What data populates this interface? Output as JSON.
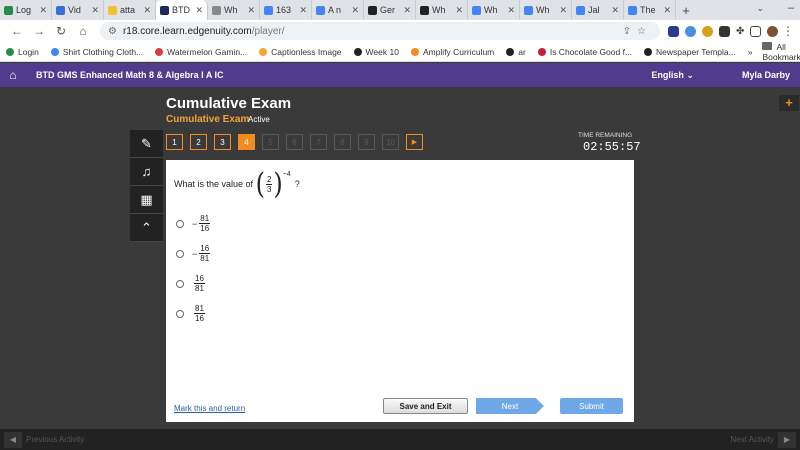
{
  "browser": {
    "tabs": [
      {
        "label": "Log",
        "color": "#2a8c4a"
      },
      {
        "label": "Vid",
        "color": "#3a6fd8"
      },
      {
        "label": "atta",
        "color": "#f2c230"
      },
      {
        "label": "BTD",
        "color": "#1c2a5a",
        "active": true
      },
      {
        "label": "Wh",
        "color": "#888888"
      },
      {
        "label": "163",
        "color": "#4285f4"
      },
      {
        "label": "A n",
        "color": "#4285f4"
      },
      {
        "label": "Ger",
        "color": "#222222"
      },
      {
        "label": "Wh",
        "color": "#222222"
      },
      {
        "label": "Wh",
        "color": "#4285f4"
      },
      {
        "label": "Wh",
        "color": "#4285f4"
      },
      {
        "label": "Jal",
        "color": "#4285f4"
      },
      {
        "label": "The",
        "color": "#4285f4"
      }
    ],
    "url_host": "r18.core.learn.edgenuity.com",
    "url_path": "/player/",
    "bookmarks": [
      {
        "label": "Login",
        "color": "#2a8c4a"
      },
      {
        "label": "Shirt Clothing Cloth...",
        "color": "#4285f4"
      },
      {
        "label": "Watermelon Gamin...",
        "color": "#d84040"
      },
      {
        "label": "Captionless Image",
        "color": "#f2a537"
      },
      {
        "label": "Week 10",
        "color": "#222222"
      },
      {
        "label": "Amplify Curriculum",
        "color": "#f28c1e"
      },
      {
        "label": "ar",
        "color": "#222222"
      },
      {
        "label": "Is Chocolate Good f...",
        "color": "#c0203a"
      },
      {
        "label": "Newspaper Templa...",
        "color": "#222222"
      }
    ],
    "all_bookmarks": "All Bookmarks"
  },
  "app": {
    "course": "BTD GMS Enhanced Math 8 & Algebra I A IC",
    "language": "English",
    "user": "Myla Darby"
  },
  "exam": {
    "title": "Cumulative Exam",
    "subtitle": "Cumulative Exam",
    "status": "Active",
    "timer_label": "TIME REMAINING",
    "timer": "02:55:57",
    "questions": [
      "1",
      "2",
      "3",
      "4",
      "5",
      "6",
      "7",
      "8",
      "9",
      "10"
    ],
    "current_question": 4
  },
  "question": {
    "prefix": "What is the value of",
    "base_num": "2",
    "base_den": "3",
    "exponent": "−4",
    "suffix": "?",
    "options": [
      {
        "sign": "−",
        "num": "81",
        "den": "16"
      },
      {
        "sign": "−",
        "num": "16",
        "den": "81"
      },
      {
        "sign": "",
        "num": "16",
        "den": "81"
      },
      {
        "sign": "",
        "num": "81",
        "den": "16"
      }
    ]
  },
  "actions": {
    "mark": "Mark this and return",
    "save": "Save and Exit",
    "next": "Next",
    "submit": "Submit"
  },
  "footer": {
    "prev": "Previous Activity",
    "next": "Next Activity"
  }
}
